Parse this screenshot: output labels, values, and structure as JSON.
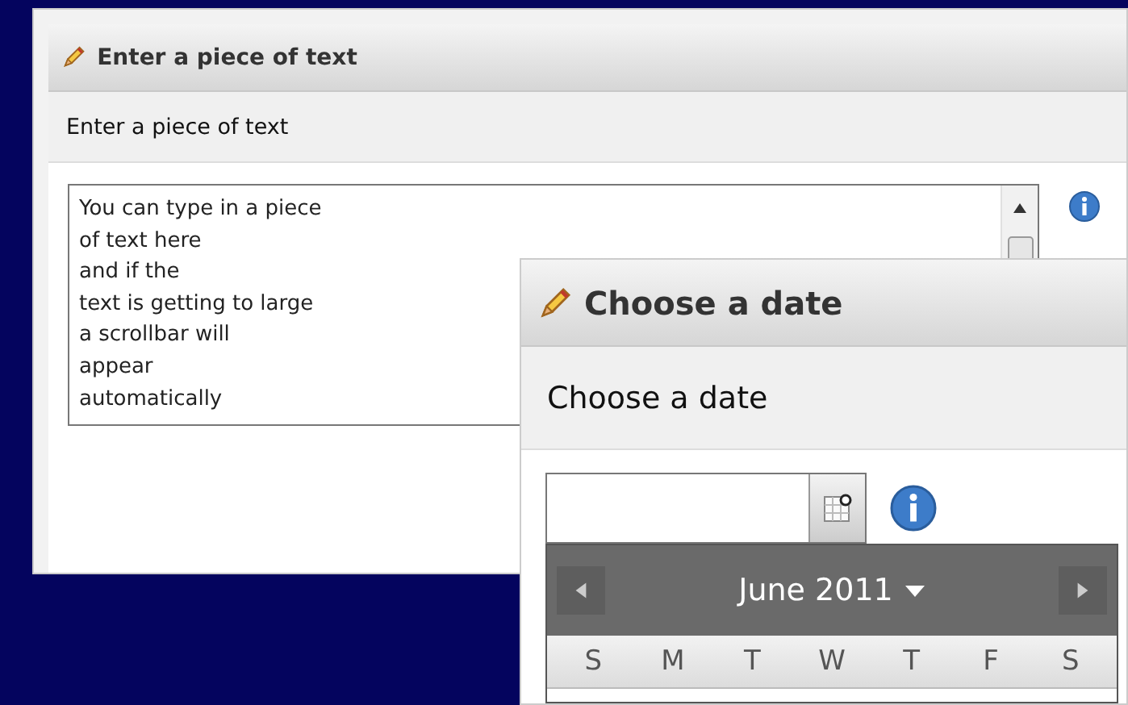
{
  "panels": [
    {
      "title": "Enter a piece of text",
      "subtitle": "Enter a piece of text",
      "field": {
        "kind": "textarea",
        "lines": [
          "You can type in a piece",
          "of text here",
          "and if the",
          "text is getting to large",
          "a scrollbar will",
          "appear",
          "automatically"
        ]
      }
    },
    {
      "title": "Choose a date",
      "subtitle": "Choose a date",
      "field": {
        "kind": "date"
      },
      "calendar": {
        "month": "June 2011",
        "weekdays": [
          "S",
          "M",
          "T",
          "W",
          "T",
          "F",
          "S"
        ]
      }
    }
  ]
}
